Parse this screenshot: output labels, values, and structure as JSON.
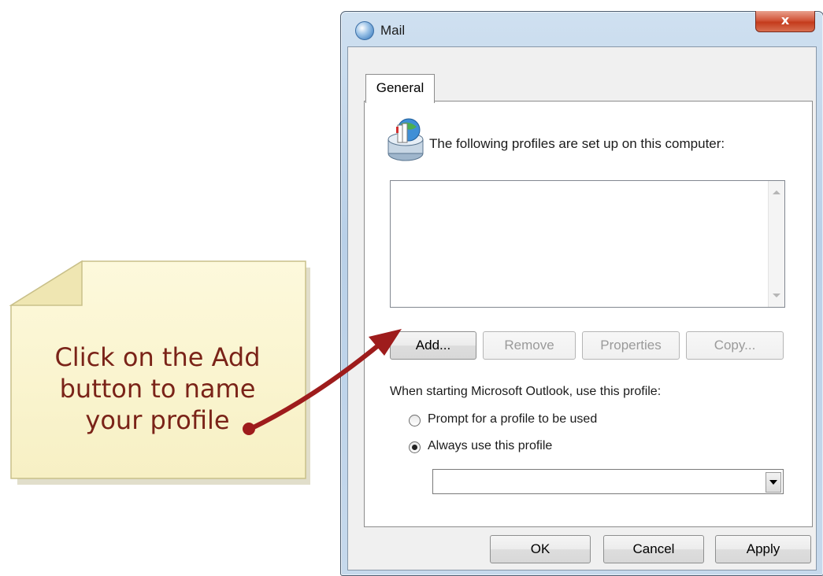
{
  "window": {
    "title": "Mail",
    "close_label": "x"
  },
  "tabs": [
    {
      "label": "General"
    }
  ],
  "profiles": {
    "label": "The following profiles are set up on this computer:",
    "items": []
  },
  "buttons": {
    "add": "Add...",
    "remove": "Remove",
    "properties": "Properties",
    "copy": "Copy..."
  },
  "startup": {
    "label": "When starting Microsoft Outlook, use this profile:",
    "options": [
      {
        "label": "Prompt for a profile to be used",
        "selected": false
      },
      {
        "label": "Always use this profile",
        "selected": true
      }
    ],
    "selected_profile": ""
  },
  "footer": {
    "ok": "OK",
    "cancel": "Cancel",
    "apply": "Apply"
  },
  "callout": {
    "lines": [
      "Click on the Add",
      "button to name",
      "your profile"
    ],
    "color": "#7a2318",
    "note_color": "#fbf6d0",
    "arrow_color": "#a01e1e"
  },
  "icons": {
    "title": "mail-icon",
    "profiles": "profiles-icon"
  }
}
